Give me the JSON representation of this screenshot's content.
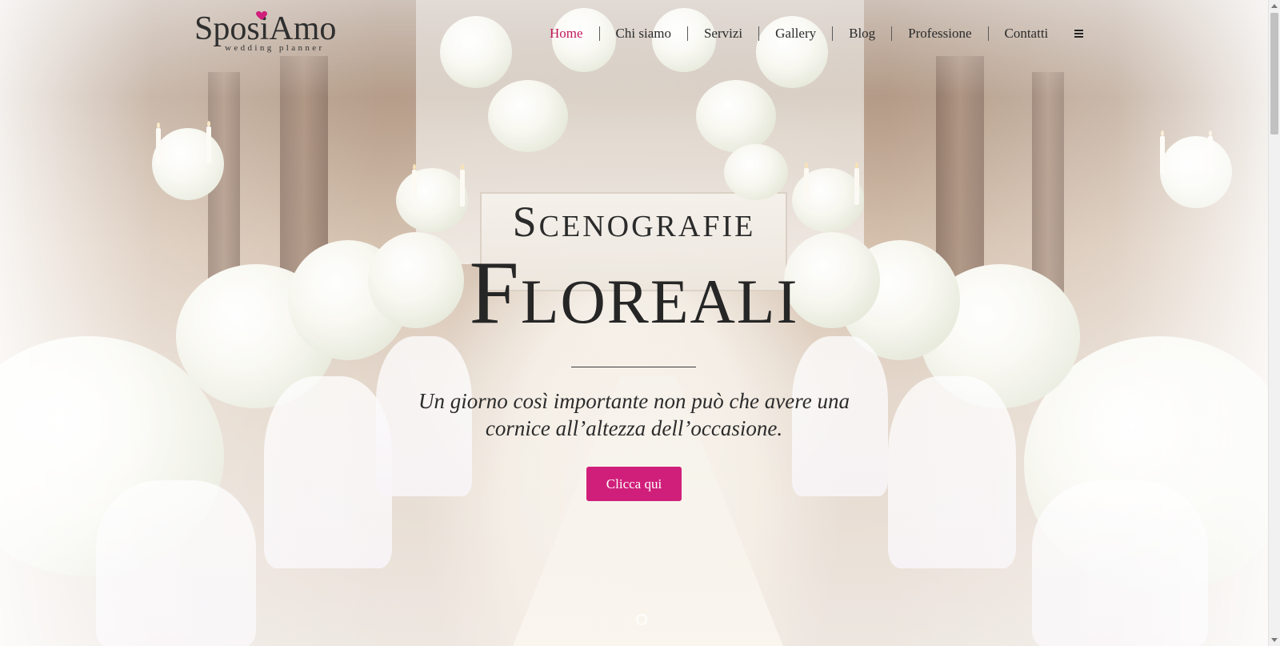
{
  "brand": {
    "name": "SposiAmo",
    "tagline": "wedding planner",
    "accent_color": "#d01f7a"
  },
  "nav": {
    "items": [
      {
        "label": "Home",
        "active": true
      },
      {
        "label": "Chi siamo",
        "active": false
      },
      {
        "label": "Servizi",
        "active": false
      },
      {
        "label": "Gallery",
        "active": false
      },
      {
        "label": "Blog",
        "active": false
      },
      {
        "label": "Professione",
        "active": false
      },
      {
        "label": "Contatti",
        "active": false
      }
    ],
    "menu_icon": "hamburger-icon"
  },
  "hero": {
    "kicker": "Scenografie",
    "title": "Floreali",
    "subtitle": "Un giorno così importante non può che avere una cornice all’altezza dell’occasione.",
    "cta_label": "Clicca qui"
  }
}
